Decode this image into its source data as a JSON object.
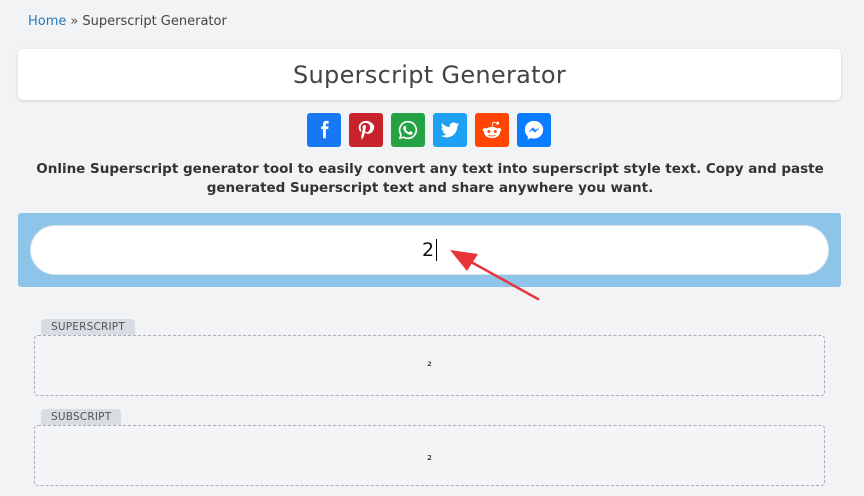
{
  "breadcrumb": {
    "home": "Home",
    "separator": "»",
    "current": "Superscript Generator"
  },
  "page_title": "Superscript Generator",
  "share_buttons": [
    {
      "icon": "facebook-icon",
      "color": "#1877f2"
    },
    {
      "icon": "pinterest-icon",
      "color": "#c8232c"
    },
    {
      "icon": "whatsapp-icon",
      "color": "#25a244"
    },
    {
      "icon": "twitter-icon",
      "color": "#1da1f2"
    },
    {
      "icon": "reddit-icon",
      "color": "#ff4500"
    },
    {
      "icon": "messenger-icon",
      "color": "#0a7cff"
    }
  ],
  "description": "Online Superscript generator tool to easily convert any text into superscript style text. Copy and paste generated Superscript text and share anywhere you want.",
  "input": {
    "value": "2"
  },
  "outputs": [
    {
      "label": "SUPERSCRIPT",
      "value": "²"
    },
    {
      "label": "SUBSCRIPT",
      "value": "₂"
    }
  ],
  "colors": {
    "input_panel": "#8dc4e8",
    "annotation_arrow": "#e8353a",
    "link": "#2a7ab8"
  }
}
